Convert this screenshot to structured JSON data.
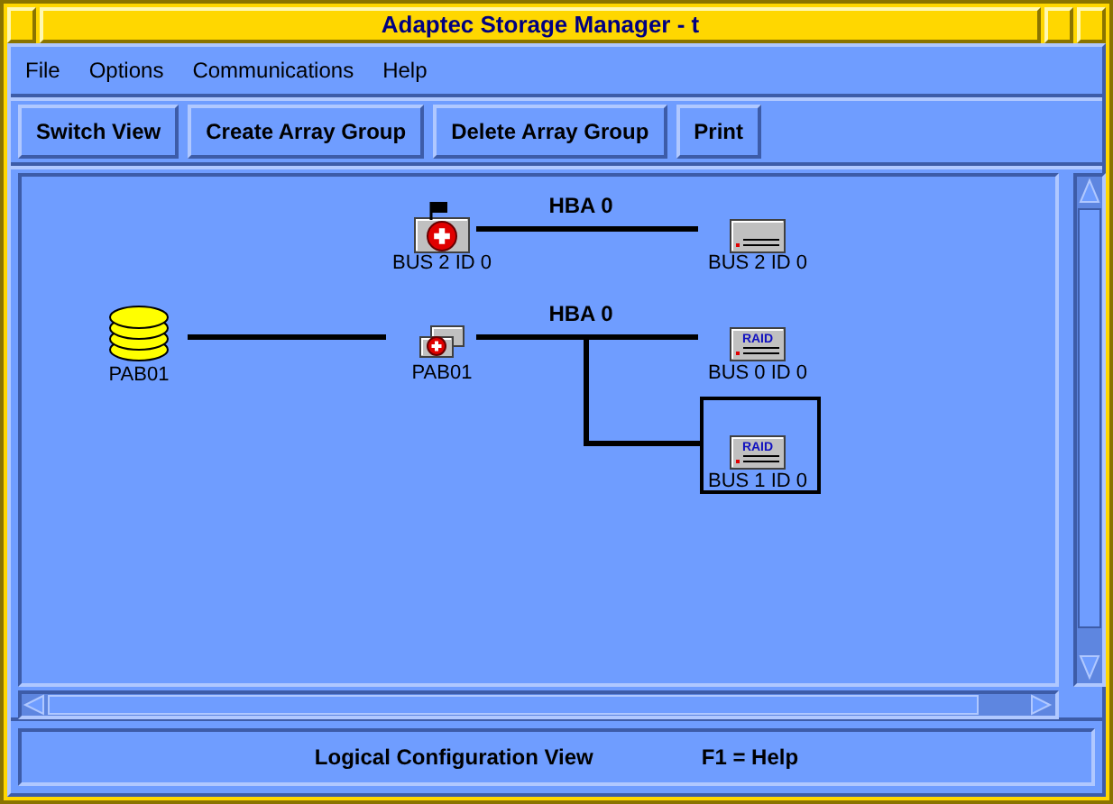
{
  "window": {
    "title": "Adaptec Storage Manager - t"
  },
  "menu": [
    {
      "label": "File"
    },
    {
      "label": "Options"
    },
    {
      "label": "Communications"
    },
    {
      "label": "Help"
    }
  ],
  "toolbar": [
    {
      "label": "Switch View"
    },
    {
      "label": "Create Array Group"
    },
    {
      "label": "Delete Array Group"
    },
    {
      "label": "Print"
    }
  ],
  "diagram": {
    "buses": [
      {
        "label": "HBA 0"
      },
      {
        "label": "HBA 0"
      }
    ],
    "nodes": [
      {
        "kind": "failed-adapter",
        "label": "BUS 2 ID 0",
        "selected": false
      },
      {
        "kind": "disk",
        "label": "BUS 2 ID 0",
        "selected": false
      },
      {
        "kind": "array",
        "label": "PAB01",
        "selected": false
      },
      {
        "kind": "adapter",
        "label": "PAB01",
        "selected": false
      },
      {
        "kind": "raid-disk",
        "label": "BUS 0 ID 0",
        "badge": "RAID",
        "selected": false
      },
      {
        "kind": "raid-disk",
        "label": "BUS 1 ID 0",
        "badge": "RAID",
        "selected": true
      }
    ]
  },
  "status_bar": [
    "Logical Configuration View",
    "F1 = Help"
  ]
}
